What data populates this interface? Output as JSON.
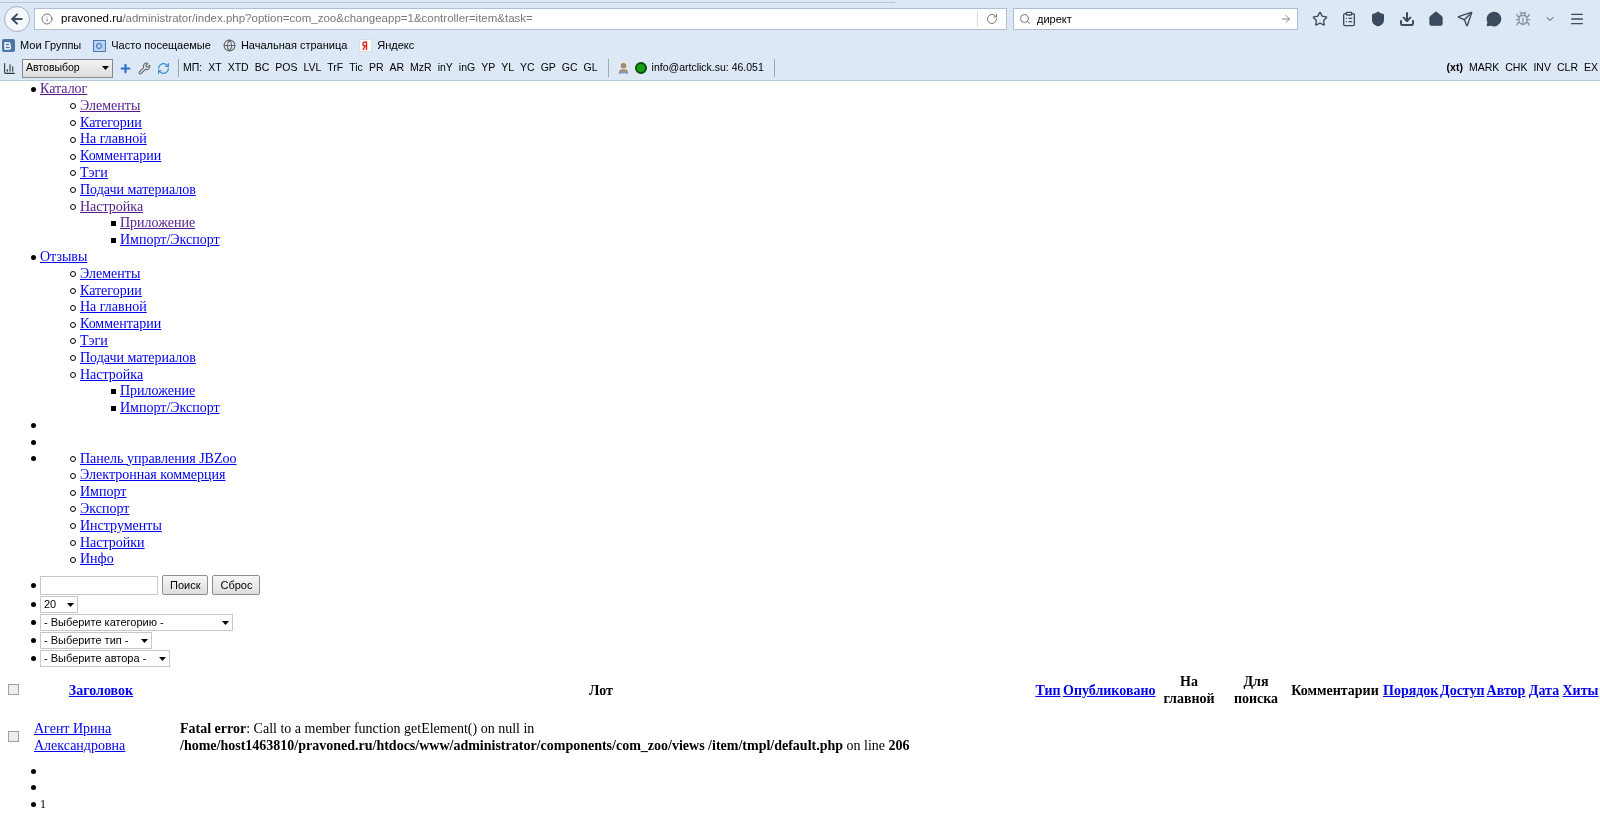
{
  "browser": {
    "url_host": "pravoned.ru",
    "url_path": "/administrator/index.php?option=com_zoo&changeapp=1&controller=item&task=",
    "search_value": "директ",
    "bookmarks": [
      {
        "kind": "vk",
        "label": "Мои Группы"
      },
      {
        "kind": "frequent",
        "label": "Часто посещаемые"
      },
      {
        "kind": "globe",
        "label": "Начальная страница"
      },
      {
        "kind": "yandex",
        "label": "Яндекс"
      }
    ],
    "addon": {
      "select": "Автовыбор",
      "prefix": "МП:",
      "items": [
        "XT",
        "XTD",
        "BC",
        "POS",
        "LVL",
        "TrF",
        "Tic",
        "PR",
        "AR",
        "MzR",
        "inY",
        "inG",
        "YP",
        "YL",
        "YC",
        "GP",
        "GC",
        "GL"
      ],
      "account": "info@artclick.su: 46.051",
      "right_label": "(xt)",
      "right_items": [
        "MARK",
        "CHK",
        "INV",
        "CLR",
        "EX"
      ]
    }
  },
  "menu": [
    {
      "kind": "link",
      "label": "Каталог",
      "visited": true,
      "children": [
        {
          "label": "Элементы",
          "visited": true
        },
        {
          "label": "Категории",
          "visited": false
        },
        {
          "label": "На главной",
          "visited": false
        },
        {
          "label": "Комментарии",
          "visited": false
        },
        {
          "label": "Тэги",
          "visited": false
        },
        {
          "label": "Подачи материалов",
          "visited": false
        },
        {
          "label": "Настройка",
          "visited": true,
          "children": [
            {
              "label": "Приложение",
              "visited": true
            },
            {
              "label": "Импорт/Экспорт",
              "visited": false
            }
          ]
        }
      ]
    },
    {
      "kind": "link",
      "label": "Отзывы",
      "visited": false,
      "children": [
        {
          "label": "Элементы",
          "visited": false
        },
        {
          "label": "Категории",
          "visited": false
        },
        {
          "label": "На главной",
          "visited": false
        },
        {
          "label": "Комментарии",
          "visited": false
        },
        {
          "label": "Тэги",
          "visited": false
        },
        {
          "label": "Подачи материалов",
          "visited": false
        },
        {
          "label": "Настройка",
          "visited": false,
          "children": [
            {
              "label": "Приложение",
              "visited": false
            },
            {
              "label": "Импорт/Экспорт",
              "visited": false
            }
          ]
        }
      ]
    },
    {
      "kind": "blank"
    },
    {
      "kind": "blank"
    },
    {
      "kind": "group",
      "children": [
        {
          "label": "Панель управления JBZoo",
          "visited": false
        },
        {
          "label": "Электронная коммерция",
          "visited": false
        },
        {
          "label": "Импорт",
          "visited": false
        },
        {
          "label": "Экспорт",
          "visited": false
        },
        {
          "label": "Инструменты",
          "visited": false
        },
        {
          "label": "Настройки",
          "visited": false
        },
        {
          "label": "Инфо",
          "visited": false
        }
      ]
    }
  ],
  "filters": {
    "search_buttons": [
      "Поиск",
      "Сброс"
    ],
    "selects": [
      "20",
      "- Выберите категорию -",
      "- Выберите тип -",
      "- Выберите автора -"
    ]
  },
  "table": {
    "select_all_checked": false,
    "columns": [
      {
        "kind": "link",
        "label": "Заголовок"
      },
      {
        "kind": "bold",
        "label": "Лот"
      },
      {
        "kind": "link",
        "label": "Тип"
      },
      {
        "kind": "link",
        "label": "Опубликовано"
      },
      {
        "kind": "bold",
        "label": "На главной"
      },
      {
        "kind": "bold",
        "label": "Для поиска"
      },
      {
        "kind": "bold",
        "label": "Комментарии"
      },
      {
        "kind": "link",
        "label": "Порядок"
      },
      {
        "kind": "link",
        "label": "Доступ"
      },
      {
        "kind": "link",
        "label": "Автор"
      },
      {
        "kind": "link",
        "label": "Дата"
      },
      {
        "kind": "link",
        "label": "Хиты"
      }
    ],
    "rows": [
      {
        "checked": false,
        "title": "Агент Ирина Александровна",
        "error": "**Fatal error**: Call to a member function getElement() on null in **/home/host1463810/pravoned.ru/htdocs/www/administrator/components/com_zoo/views /item/tmpl/default.php** on line **206**"
      }
    ]
  },
  "pagination": [
    {
      "kind": "blank"
    },
    {
      "kind": "blank"
    },
    {
      "kind": "page",
      "label": "1"
    }
  ]
}
